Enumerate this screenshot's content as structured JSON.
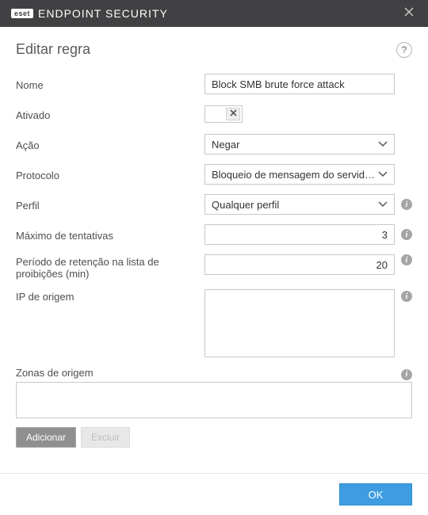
{
  "titlebar": {
    "brand_badge": "eset",
    "brand_text": "ENDPOINT SECURITY"
  },
  "header": {
    "title": "Editar regra"
  },
  "form": {
    "name_label": "Nome",
    "name_value": "Block SMB brute force attack",
    "enabled_label": "Ativado",
    "enabled_state": "off",
    "action_label": "Ação",
    "action_value": "Negar",
    "protocol_label": "Protocolo",
    "protocol_value": "Bloqueio de mensagem do servidor (SMB)",
    "profile_label": "Perfil",
    "profile_value": "Qualquer perfil",
    "max_attempts_label": "Máximo de tentativas",
    "max_attempts_value": "3",
    "retention_label": "Período de retenção na lista de proibições (min)",
    "retention_value": "20",
    "source_ip_label": "IP de origem",
    "source_ip_value": "",
    "source_zones_label": "Zonas de origem",
    "source_zones_value": ""
  },
  "buttons": {
    "add": "Adicionar",
    "delete": "Excluir",
    "ok": "OK"
  }
}
